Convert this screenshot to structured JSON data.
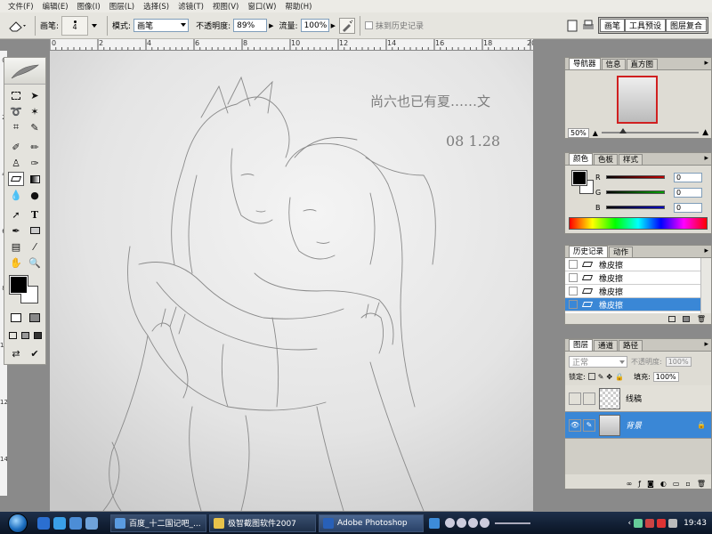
{
  "menu": [
    "文件(F)",
    "编辑(E)",
    "图像(I)",
    "图层(L)",
    "选择(S)",
    "滤镜(T)",
    "视图(V)",
    "窗口(W)",
    "帮助(H)"
  ],
  "options": {
    "brush_label": "画笔:",
    "brush_size": "4",
    "mode_label": "模式:",
    "mode_value": "画笔",
    "opacity_label": "不透明度:",
    "opacity_value": "89%",
    "flow_label": "流量:",
    "flow_value": "100%",
    "erase_history_label": "抹到历史记录",
    "dock_tabs": [
      "画笔",
      "工具预设",
      "图层复合"
    ]
  },
  "ruler": {
    "top": [
      "0",
      "2",
      "4",
      "6",
      "8",
      "10",
      "12",
      "14",
      "16",
      "18",
      "20"
    ],
    "left": [
      "0",
      "2",
      "4",
      "6",
      "8",
      "10",
      "12",
      "14"
    ]
  },
  "canvas": {
    "handwriting_line1": "尚六也已有夏……文",
    "handwriting_line2": "08 1.28"
  },
  "navigator": {
    "tabs": [
      "导航器",
      "信息",
      "直方图"
    ],
    "zoom": "50%"
  },
  "color": {
    "tabs": [
      "颜色",
      "色板",
      "样式"
    ],
    "channels": [
      {
        "label": "R",
        "value": "0",
        "color": "#c00000"
      },
      {
        "label": "G",
        "value": "0",
        "color": "#00a000"
      },
      {
        "label": "B",
        "value": "0",
        "color": "#0000c0"
      }
    ]
  },
  "history": {
    "tabs": [
      "历史记录",
      "动作"
    ],
    "items": [
      "橡皮擦",
      "橡皮擦",
      "橡皮擦",
      "橡皮擦"
    ],
    "selected_index": 3
  },
  "layers": {
    "tabs": [
      "图层",
      "通道",
      "路径"
    ],
    "blend_mode": "正常",
    "opacity_label": "不透明度:",
    "opacity_value": "100%",
    "lock_label": "锁定:",
    "fill_label": "填充:",
    "fill_value": "100%",
    "items": [
      {
        "name": "线稿",
        "visible": false,
        "selected": false
      },
      {
        "name": "背景",
        "visible": true,
        "selected": true
      }
    ]
  },
  "taskbar": {
    "buttons": [
      "百度_十二国记吧_...",
      "极智截图软件2007",
      "Adobe Photoshop"
    ],
    "clock": "19:43"
  },
  "colors": {
    "accent": "#3a78c8",
    "panel_bg": "#dedcd4",
    "selected_row": "#3a87d6"
  }
}
